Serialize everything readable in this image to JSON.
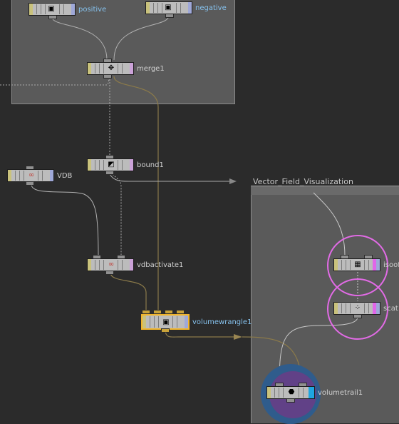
{
  "network_box": {
    "title": "Vector_Field_Visualization"
  },
  "nodes": {
    "positive": {
      "label": "positive",
      "icon": "cube-warp-icon"
    },
    "negative": {
      "label": "negative",
      "icon": "cube-warp-icon"
    },
    "merge1": {
      "label": "merge1",
      "icon": "merge-icon"
    },
    "bound1": {
      "label": "bound1",
      "icon": "bound-icon"
    },
    "vdb": {
      "label": "VDB",
      "icon": "vdb-icon"
    },
    "vdbactivate1": {
      "label": "vdbactivate1",
      "icon": "vdb-icon"
    },
    "volumewrangle1": {
      "label": "volumewrangle1",
      "icon": "wrangle-icon"
    },
    "isooffset": {
      "label": "isoof",
      "icon": "isooffset-icon"
    },
    "scatter": {
      "label": "scat",
      "icon": "scatter-icon"
    },
    "volumetrail1": {
      "label": "volumetrail1",
      "icon": "volumetrail-icon"
    }
  },
  "colors": {
    "background": "#2b2b2b",
    "network_box": "#5a5a5a",
    "selected_outline": "#f2b52b",
    "highlight_ring": "#e26be6",
    "wire": "#b0b0b0",
    "wire_active": "#8b7a4a",
    "label_blue": "#86c2ee"
  }
}
